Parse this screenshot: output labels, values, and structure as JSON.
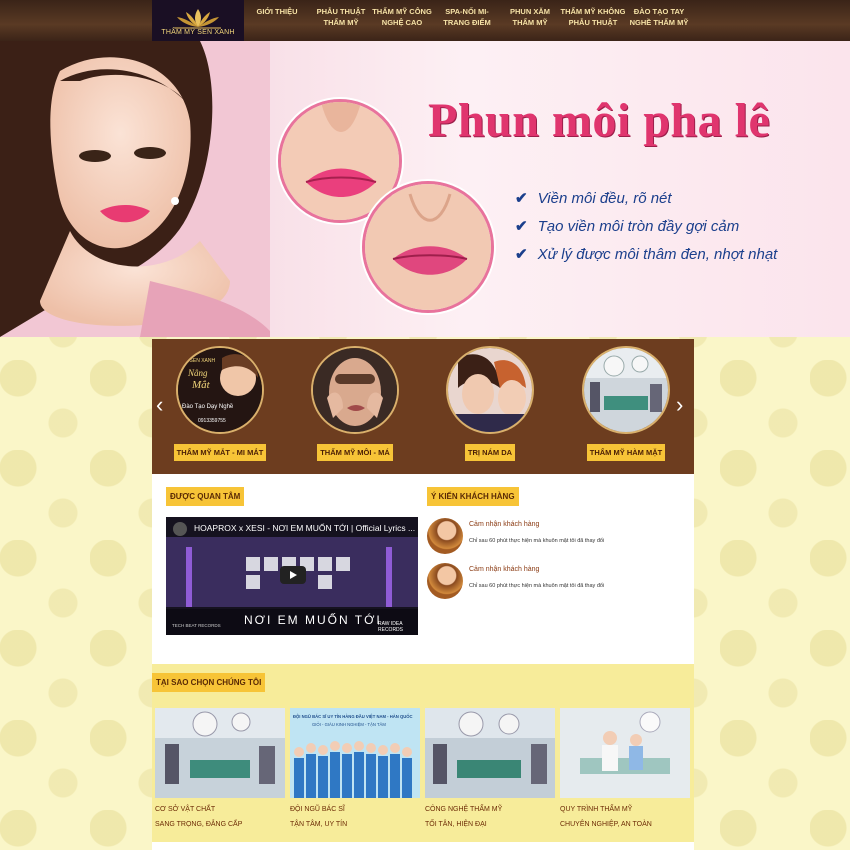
{
  "brand": {
    "logo_text": "THẨM MỸ SEN XANH"
  },
  "nav": [
    "GIỚI THIỆU",
    "PHẪU THUẬT THẨM MỸ",
    "THẨM MỸ CÔNG NGHỆ CAO",
    "SPA-NỐI MI-TRANG ĐIỂM",
    "PHUN XĂM THẨM MỸ",
    "THẨM MỸ KHÔNG PHẪU THUẬT",
    "ĐÀO TẠO TAY NGHỀ THẨM MỸ"
  ],
  "hero": {
    "title": "Phun môi pha lê",
    "bullets": [
      "Viền môi đều, rõ nét",
      "Tạo viền môi tròn đầy gợi cảm",
      "Xử lý được môi thâm đen, nhợt nhạt"
    ]
  },
  "services": [
    {
      "label": "THẨM MỸ MẮT - MI MẮT",
      "overlay_lines": [
        "M SEN XANH",
        "Nâng",
        "Mắt",
        "Đào Tạo Dạy Nghề",
        "0913359755"
      ]
    },
    {
      "label": "THẨM MỸ MÔI - MÁ"
    },
    {
      "label": "TRỊ NÁM DA"
    },
    {
      "label": "THẨM MỸ HÀM MẶT"
    }
  ],
  "featured": {
    "heading": "ĐƯỢC QUAN TÂM",
    "video_title": "HOAPROX x XESI - NƠI EM MUỐN TỚI | Official Lyrics ...",
    "video_footer": "NƠI EM MUỐN TỚI",
    "video_corner_left": "TECH BEAT RECORDS",
    "video_corner_right": "RAW IDEA RECORDS"
  },
  "feedback": {
    "heading": "Ý KIẾN KHÁCH HÀNG",
    "items": [
      {
        "name": "Cảm nhận khách hàng",
        "text": "Chỉ sau 60 phút thực hiện mà khuôn mặt tôi đã thay đổi"
      },
      {
        "name": "Cảm nhận khách hàng",
        "text": "Chỉ sau 60 phút thực hiện mà khuôn mặt tôi đã thay đổi"
      }
    ]
  },
  "why": {
    "heading": "TẠI SAO CHỌN CHÚNG TÔI",
    "cards": [
      {
        "title": "CƠ SỞ VẬT CHẤT",
        "subtitle": "SANG TRỌNG, ĐẲNG CẤP"
      },
      {
        "title": "ĐỘI NGŨ BÁC SĨ",
        "subtitle": "TẬN TÂM, UY TÍN",
        "banner": "ĐỘI NGŨ BÁC SĨ UY TÍN HÀNG ĐẦU VIỆT NAM - HÀN QUỐC",
        "banner_sub": "GIỎI - GIÀU KINH NGHIỆM - TẬN TÂM"
      },
      {
        "title": "CÔNG NGHỆ THẨM MỸ",
        "subtitle": "TỐI TÂN, HIỆN ĐẠI"
      },
      {
        "title": "QUY TRÌNH THẨM MỸ",
        "subtitle": "CHUYÊN NGHIỆP, AN TOÀN"
      }
    ]
  },
  "colors": {
    "accent": "#f7c437",
    "brown": "#6d3d1f",
    "hero_title": "#e0356e",
    "bullet_text": "#1b3f8c"
  }
}
